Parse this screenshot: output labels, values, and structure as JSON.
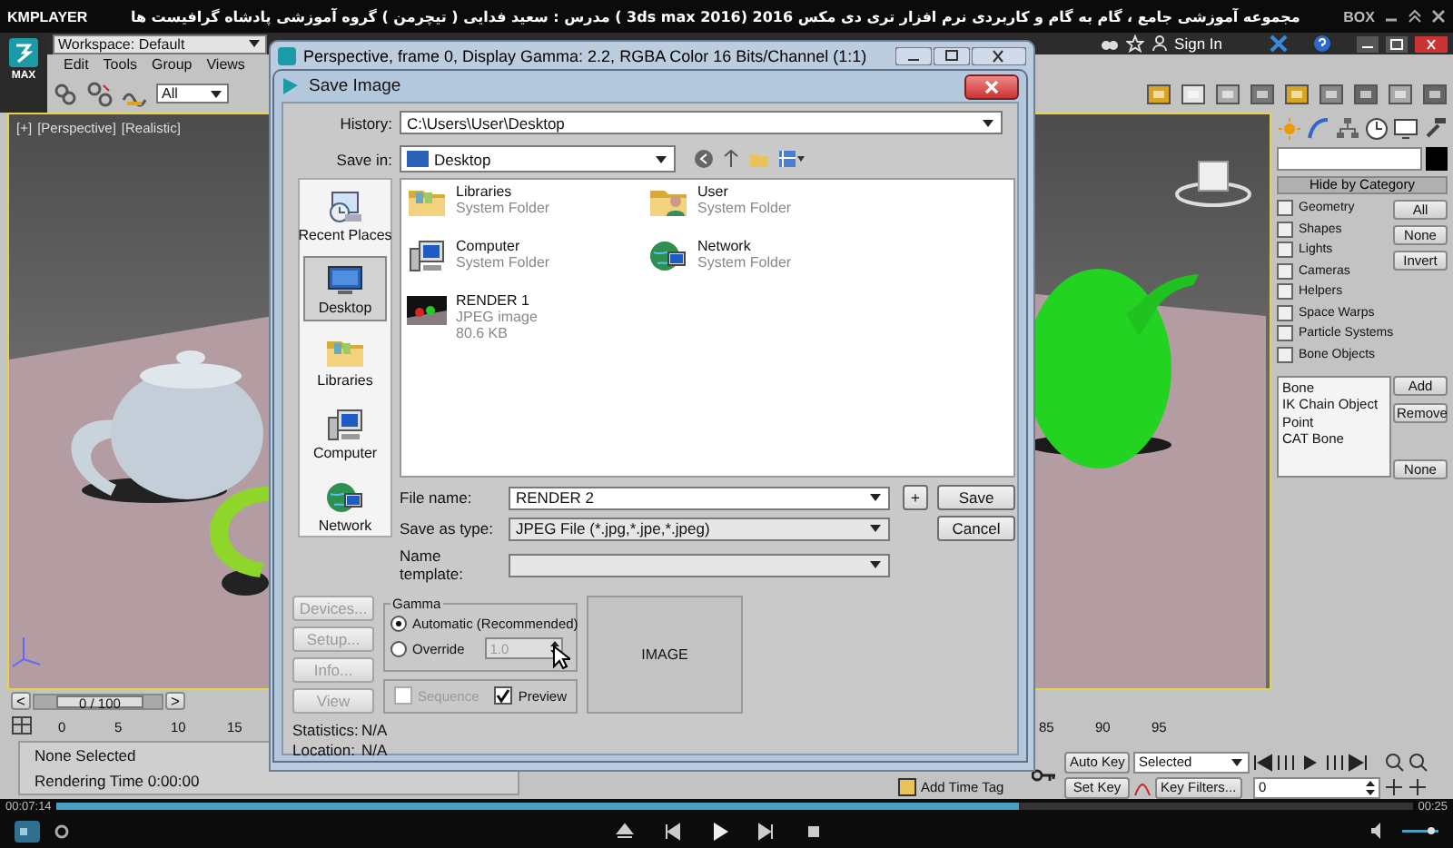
{
  "player": {
    "name": "KMPLAYER",
    "video_title": "مجموعه آموزشی جامع ، گام به گام و کاربردی نرم افزار تری دی مکس 2016 (3ds max 2016 ) مدرس : سعید فدایی ( تیچرمن ) گروه آموزشی پادشاه گرافیست ها",
    "badge": "BOX"
  },
  "max": {
    "logo_label": "MAX",
    "workspace": "Workspace: Default",
    "sign_in": "Sign In",
    "menu": [
      "Edit",
      "Tools",
      "Group",
      "Views"
    ],
    "selection_filter": "All",
    "viewport": {
      "labels": [
        "[+]",
        "[Perspective]",
        "[Realistic]"
      ]
    },
    "command_panel": {
      "rollout": "Hide by Category",
      "categories": [
        {
          "label": "Geometry",
          "checked": false
        },
        {
          "label": "Shapes",
          "checked": false
        },
        {
          "label": "Lights",
          "checked": false
        },
        {
          "label": "Cameras",
          "checked": false
        },
        {
          "label": "Helpers",
          "checked": false
        },
        {
          "label": "Space Warps",
          "checked": false
        },
        {
          "label": "Particle Systems",
          "checked": false
        },
        {
          "label": "Bone Objects",
          "checked": false
        }
      ],
      "buttons": [
        "All",
        "None",
        "Invert"
      ],
      "list": [
        "Bone",
        "IK Chain Object",
        "Point",
        "CAT Bone"
      ],
      "list_buttons": [
        "Add",
        "Remove",
        "None"
      ]
    },
    "time_slider": {
      "prev": "<",
      "position": "0 / 100",
      "next": ">"
    },
    "ruler": {
      "start": [
        "0",
        "5",
        "10",
        "15"
      ],
      "end": [
        "85",
        "90",
        "95"
      ]
    },
    "status": {
      "selection": "None Selected",
      "prompt": "Rendering Time  0:00:00"
    },
    "key_controls": {
      "add_time_tag": "Add Time Tag",
      "auto_key": "Auto Key",
      "key_mode": "Selected",
      "set_key": "Set Key",
      "key_filters": "Key Filters...",
      "frame": "0"
    }
  },
  "frame_window": {
    "title": "Perspective, frame 0, Display Gamma: 2.2, RGBA Color 16 Bits/Channel (1:1)"
  },
  "save_dialog": {
    "title": "Save Image",
    "history_label": "History:",
    "history": "C:\\Users\\User\\Desktop",
    "save_in_label": "Save in:",
    "save_in": "Desktop",
    "places": [
      {
        "label": "Recent Places",
        "kind": "recent",
        "selected": false
      },
      {
        "label": "Desktop",
        "kind": "desktop",
        "selected": true
      },
      {
        "label": "Libraries",
        "kind": "libraries",
        "selected": false
      },
      {
        "label": "Computer",
        "kind": "computer",
        "selected": false
      },
      {
        "label": "Network",
        "kind": "network",
        "selected": false
      }
    ],
    "files": [
      {
        "name": "Libraries",
        "details": [
          "System Folder"
        ],
        "kind": "libraries"
      },
      {
        "name": "User",
        "details": [
          "System Folder"
        ],
        "kind": "user"
      },
      {
        "name": "Computer",
        "details": [
          "System Folder"
        ],
        "kind": "computer"
      },
      {
        "name": "Network",
        "details": [
          "System Folder"
        ],
        "kind": "network"
      },
      {
        "name": "RENDER 1",
        "details": [
          "JPEG image",
          "80.6 KB"
        ],
        "kind": "image"
      }
    ],
    "file_name_label": "File name:",
    "file_name": "RENDER 2",
    "plus": "+",
    "save_as_label": "Save as type:",
    "save_as": "JPEG File (*.jpg,*.jpe,*.jpeg)",
    "template_label": "Name template:",
    "buttons": [
      "Save",
      "Cancel"
    ],
    "side_buttons": [
      {
        "label": "Devices...",
        "disabled": true
      },
      {
        "label": "Setup...",
        "disabled": true
      },
      {
        "label": "Info...",
        "disabled": true
      },
      {
        "label": "View",
        "disabled": true
      }
    ],
    "gamma": {
      "title": "Gamma",
      "options": [
        {
          "label": "Automatic (Recommended)",
          "selected": true
        },
        {
          "label": "Override",
          "selected": false
        }
      ],
      "override_value": "1.0"
    },
    "sequence": {
      "label": "Sequence",
      "checked": false,
      "disabled": true
    },
    "preview": {
      "label": "Preview",
      "checked": true,
      "disabled": false
    },
    "image_label": "IMAGE",
    "stats": [
      {
        "label": "Statistics:",
        "value": "N/A"
      },
      {
        "label": "Location:",
        "value": "N/A"
      }
    ]
  },
  "player_controls": {
    "elapsed": "00:07:14",
    "total": "00:25",
    "level": 0.71
  }
}
